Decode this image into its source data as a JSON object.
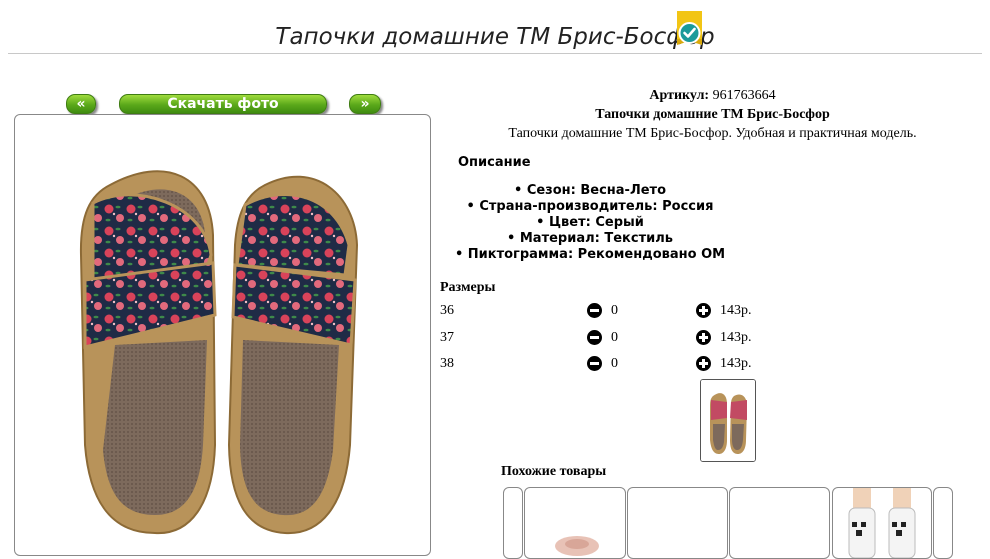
{
  "page": {
    "title": "Тапочки домашние ТМ Брис-Босфор"
  },
  "gallery": {
    "prev_label": "«",
    "download_label": "Скачать фото",
    "next_label": "»"
  },
  "product": {
    "article_label": "Артикул:",
    "article_value": "961763664",
    "name": "Тапочки домашние ТМ Брис-Босфор",
    "short_description": "Тапочки домашние ТМ Брис-Босфор. Удобная и практичная модель.",
    "description_heading": "Описание",
    "attributes": [
      "Сезон: Весна-Лето",
      "Страна-производитель: Россия",
      "Цвет: Серый",
      "Материал: Текстиль",
      "Пиктограмма: Рекомендовано ОМ"
    ]
  },
  "sizes": {
    "heading": "Размеры",
    "rows": [
      {
        "size": "36",
        "qty": "0",
        "price": "143р."
      },
      {
        "size": "37",
        "qty": "0",
        "price": "143р."
      },
      {
        "size": "38",
        "qty": "0",
        "price": "143р."
      }
    ]
  },
  "similar": {
    "heading": "Похожие товары"
  },
  "colors": {
    "button_green": "#5aa81a",
    "badge_yellow": "#f2c515",
    "badge_teal": "#1a9a9a"
  }
}
